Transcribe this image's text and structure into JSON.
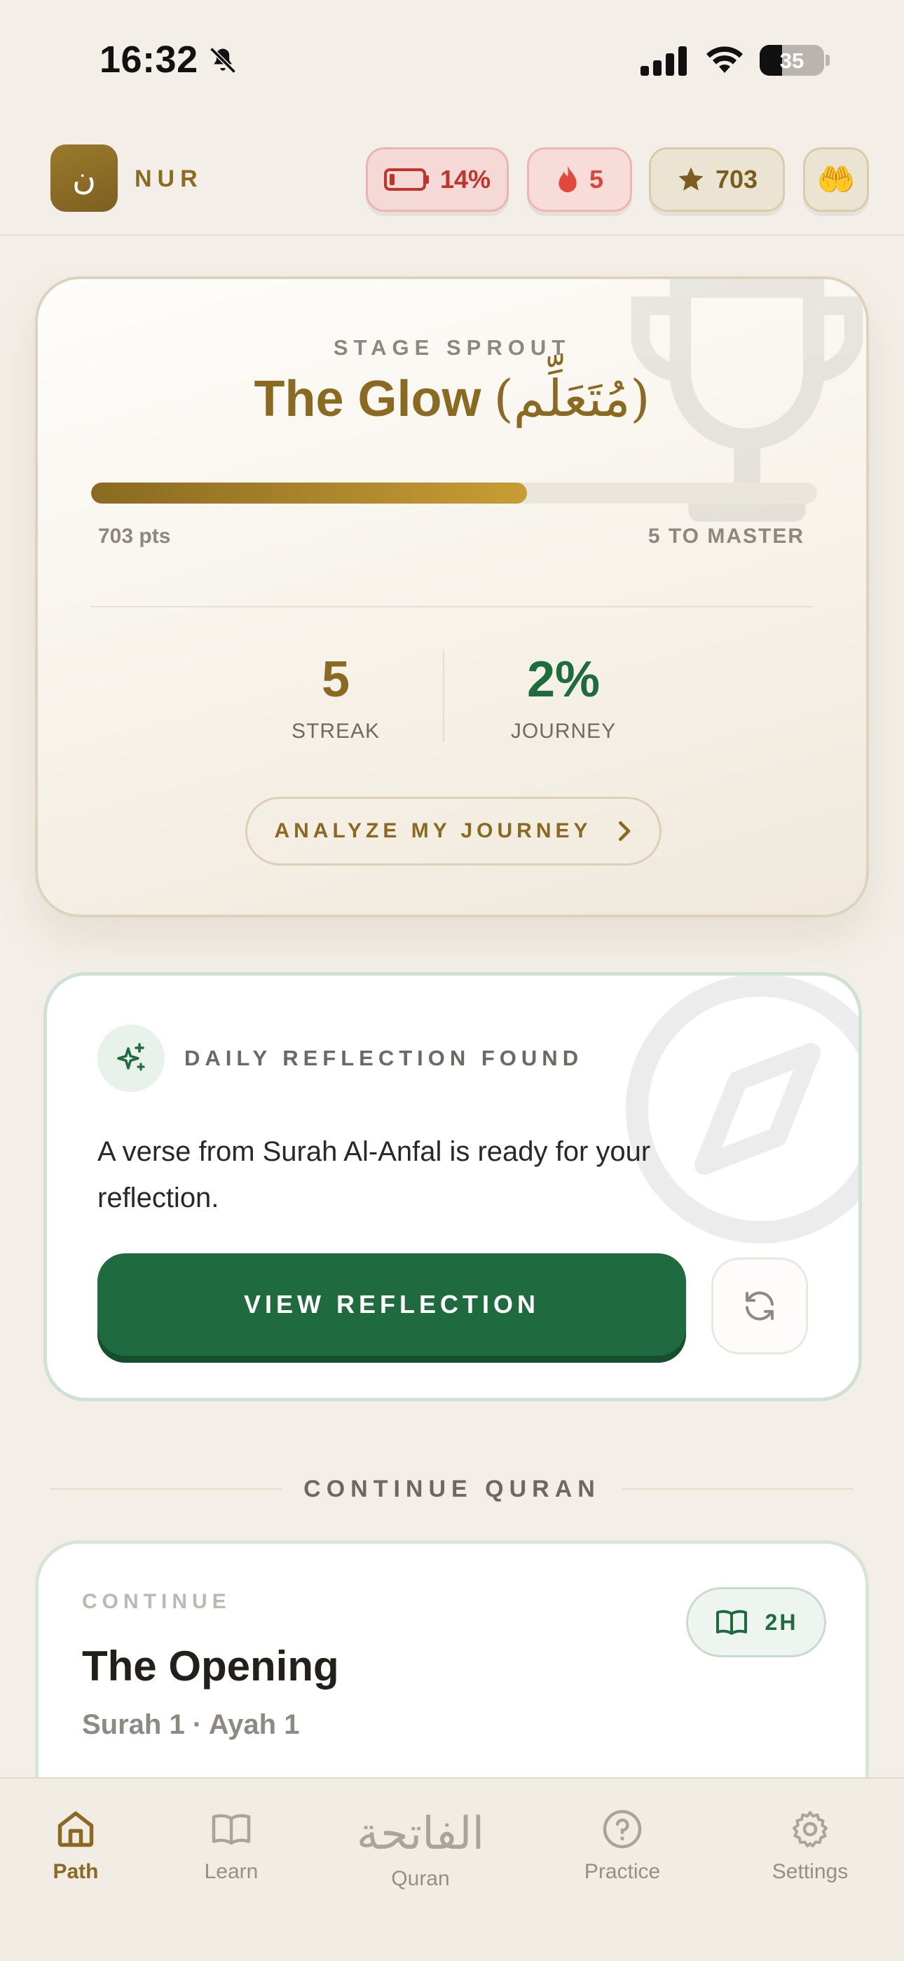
{
  "status_bar": {
    "time": "16:32",
    "battery": "35"
  },
  "header": {
    "logo_letter": "ن",
    "brand": "NUR",
    "battery_pct": "14%",
    "streak": "5",
    "points": "703",
    "hands_emoji": "🤲"
  },
  "stage": {
    "label": "STAGE SPROUT",
    "title": "The Glow",
    "arabic": "(مُتَعَلِّم)",
    "progress": 0.6,
    "points_text": "703 pts",
    "to_master": "5 TO MASTER",
    "streak_value": "5",
    "streak_label": "STREAK",
    "journey_value": "2%",
    "journey_label": "JOURNEY",
    "analyze_label": "ANALYZE MY JOURNEY"
  },
  "reflection": {
    "label": "DAILY REFLECTION FOUND",
    "text": "A verse from Surah Al-Anfal is ready for your reflection.",
    "button": "VIEW REFLECTION"
  },
  "continue_quran": {
    "section_title": "CONTINUE QURAN",
    "label": "CONTINUE",
    "title": "The Opening",
    "subtitle": "Surah 1 · Ayah 1",
    "time": "2H"
  },
  "tabs": {
    "path": "Path",
    "learn": "Learn",
    "quran_glyph": "الفاتحة",
    "quran": "Quran",
    "practice": "Practice",
    "settings": "Settings"
  },
  "colors": {
    "gold": "#8a6a20",
    "green": "#1f6b3f",
    "background": "#f3efe8",
    "danger": "#d9463a"
  }
}
